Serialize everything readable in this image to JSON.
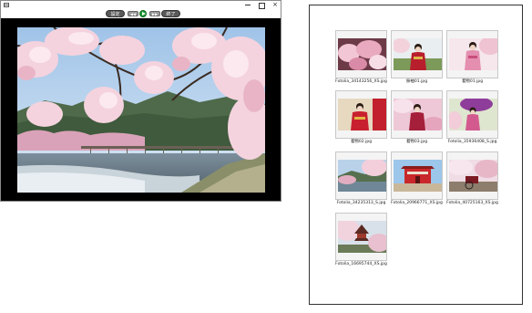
{
  "viewer": {
    "controls": {
      "settings_label": "設定",
      "prev_label": "◀◀",
      "next_label": "▶▶",
      "end_label": "終了"
    },
    "window_controls": {
      "minimize": "",
      "maximize": "",
      "close": "×"
    }
  },
  "gallery": {
    "thumbnails": [
      {
        "filename": "Fotolia_34143256_XS.jpg"
      },
      {
        "filename": "振袖01.jpg"
      },
      {
        "filename": "着物01.jpg"
      },
      {
        "filename": "着物02.jpg"
      },
      {
        "filename": "着物03.jpg"
      },
      {
        "filename": "Fotolia_35936408_S.jpg"
      },
      {
        "filename": "Fotolia_34235313_S.jpg"
      },
      {
        "filename": "Fotolia_20966771_XS.jpg"
      },
      {
        "filename": "Fotolia_40725163_XS.jpg"
      },
      {
        "filename": "Fotolia_16695744_XS.jpg"
      }
    ]
  }
}
